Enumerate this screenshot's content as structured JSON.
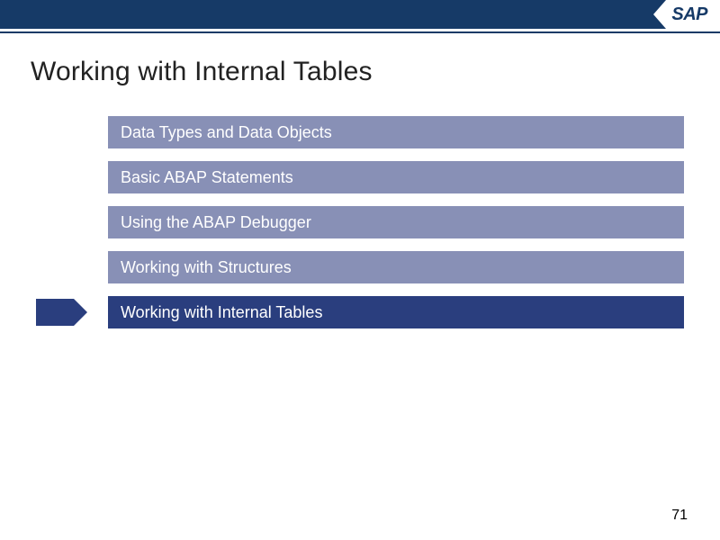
{
  "header": {
    "logo": "SAP"
  },
  "title": "Working with Internal Tables",
  "agenda": {
    "items": [
      {
        "label": "Data Types and Data Objects",
        "active": false
      },
      {
        "label": "Basic ABAP Statements",
        "active": false
      },
      {
        "label": "Using the ABAP Debugger",
        "active": false
      },
      {
        "label": "Working with Structures",
        "active": false
      },
      {
        "label": "Working with Internal Tables",
        "active": true
      }
    ]
  },
  "page_number": "71"
}
